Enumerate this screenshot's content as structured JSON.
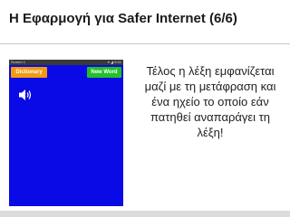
{
  "slide": {
    "title": "Η Εφαρμογή για Safer Internet (6/6)",
    "caption": "Τέλος η λέξη εμφανίζεται μαζί με τη μετάφραση και ένα ηχείο το οποίο εάν πατηθεί αναπαράγει τη λέξη!"
  },
  "phone": {
    "status_title": "Screen 1",
    "status_right": "▾ ◢ 9:41",
    "dictionary_button": "Dictionary",
    "new_word_button": "New Word",
    "speaker_icon": "speaker-icon",
    "word_original": "",
    "word_translation": "",
    "small_label": ""
  },
  "colors": {
    "phone_bg": "#0a0ae6",
    "dictionary_btn": "#f29a0f",
    "new_word_btn": "#22c02a"
  }
}
